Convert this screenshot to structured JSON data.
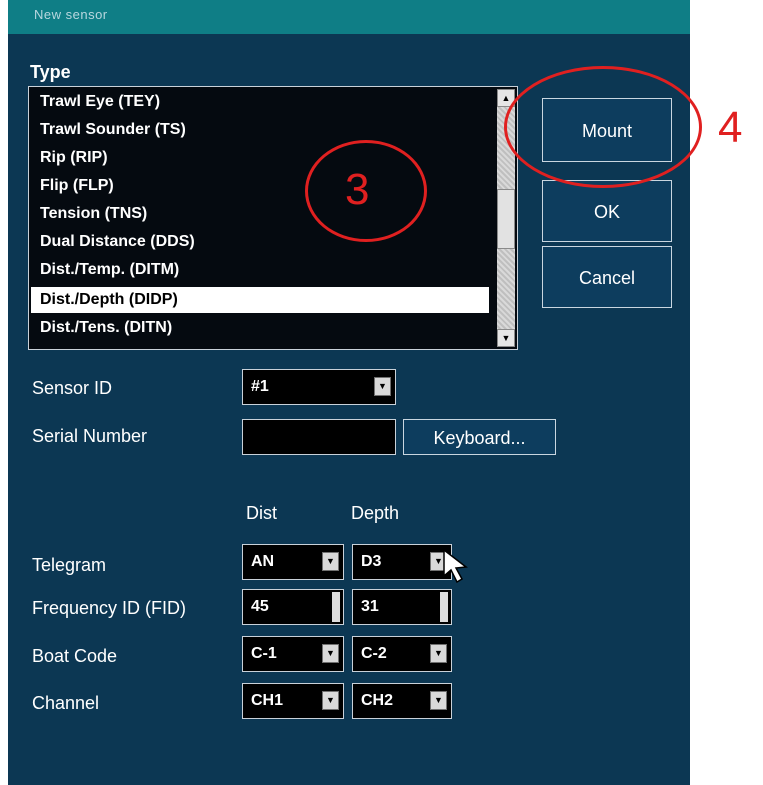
{
  "window": {
    "title": "New sensor"
  },
  "type_section": {
    "label": "Type",
    "items": [
      "Trawl Eye  (TEY)",
      "Trawl Sounder  (TS)",
      "Rip  (RIP)",
      "Flip  (FLP)",
      "Tension  (TNS)",
      "Dual Distance  (DDS)",
      "Dist./Temp.  (DITM)",
      "Dist./Depth  (DIDP)",
      "Dist./Tens.  (DITN)"
    ],
    "selected_index": 7
  },
  "buttons": {
    "mount": "Mount",
    "ok": "OK",
    "cancel": "Cancel",
    "keyboard": "Keyboard..."
  },
  "sensor_id": {
    "label": "Sensor ID",
    "value": "#1"
  },
  "serial_number": {
    "label": "Serial Number",
    "value": ""
  },
  "columns": {
    "dist": "Dist",
    "depth": "Depth"
  },
  "rows": {
    "telegram": {
      "label": "Telegram",
      "dist": "AN",
      "depth": "D3"
    },
    "frequency_id": {
      "label": "Frequency ID (FID)",
      "dist": "45",
      "depth": "31"
    },
    "boat_code": {
      "label": "Boat Code",
      "dist": "C-1",
      "depth": "C-2"
    },
    "channel": {
      "label": "Channel",
      "dist": "CH1",
      "depth": "CH2"
    }
  },
  "annotations": {
    "step3": "3",
    "step4": "4",
    "color": "#e02020"
  },
  "colors": {
    "dialog_bg": "#0c3753",
    "titlebar_bg": "#0f7e86",
    "list_bg": "#050a10"
  }
}
